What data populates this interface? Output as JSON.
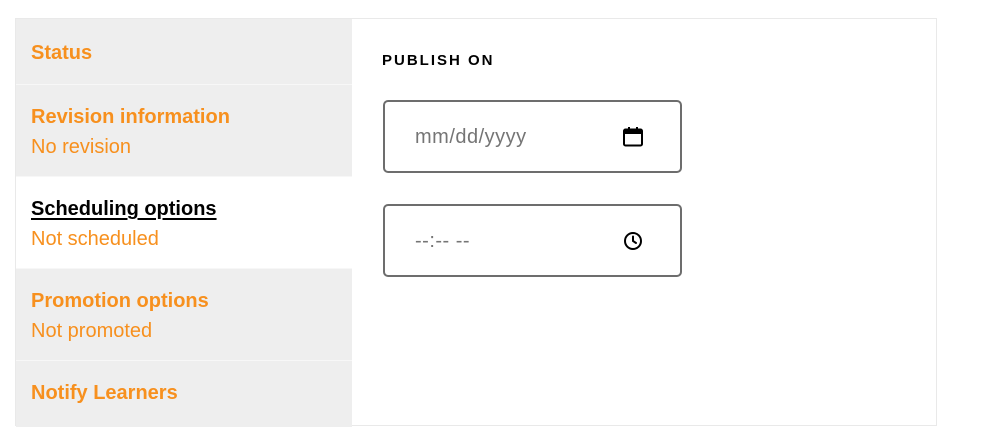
{
  "tabs": [
    {
      "title": "Status",
      "summary": ""
    },
    {
      "title": "Revision information",
      "summary": "No revision"
    },
    {
      "title": "Scheduling options",
      "summary": "Not scheduled"
    },
    {
      "title": "Promotion options",
      "summary": "Not promoted"
    },
    {
      "title": "Notify Learners",
      "summary": ""
    }
  ],
  "active_tab": "Scheduling options",
  "content": {
    "section_label": "PUBLISH ON",
    "date_input": {
      "placeholder": "mm/dd/yyyy",
      "value": "",
      "icon": "calendar-icon"
    },
    "time_input": {
      "placeholder": "--:-- --",
      "value": "",
      "icon": "clock-icon"
    }
  },
  "colors": {
    "accent": "#f7901e",
    "tab_background": "#eeeeee",
    "active_tab_background": "#ffffff",
    "input_border": "#6d6d6d"
  }
}
